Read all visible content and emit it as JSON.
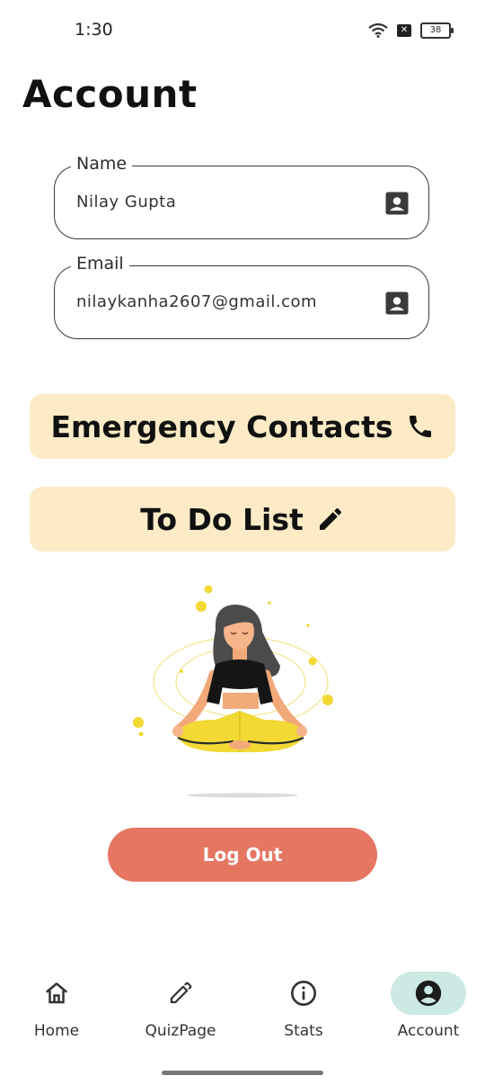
{
  "status_bar": {
    "time": "1:30",
    "battery": "38",
    "wifi_icon": "wifi-icon",
    "notification_icon": "x-box-icon"
  },
  "page": {
    "title": "Account"
  },
  "fields": {
    "name": {
      "label": "Name",
      "value": "Nilay Gupta",
      "icon": "contact-card-icon"
    },
    "email": {
      "label": "Email",
      "value": "nilaykanha2607@gmail.com",
      "icon": "contact-card-icon"
    }
  },
  "buttons": {
    "emergency": {
      "label": "Emergency Contacts",
      "icon": "phone-icon"
    },
    "todo": {
      "label": "To Do List",
      "icon": "pencil-icon"
    },
    "logout": {
      "label": "Log Out"
    }
  },
  "illustration": {
    "name": "meditating-woman-illustration"
  },
  "nav": {
    "items": [
      {
        "label": "Home",
        "icon": "home-icon",
        "active": false
      },
      {
        "label": "QuizPage",
        "icon": "pencil-icon",
        "active": false
      },
      {
        "label": "Stats",
        "icon": "info-icon",
        "active": false
      },
      {
        "label": "Account",
        "icon": "account-circle-icon",
        "active": true
      }
    ]
  },
  "colors": {
    "button_bg": "#fcebc6",
    "logout_bg": "#e57662",
    "nav_active_bg": "#cde9e4"
  }
}
